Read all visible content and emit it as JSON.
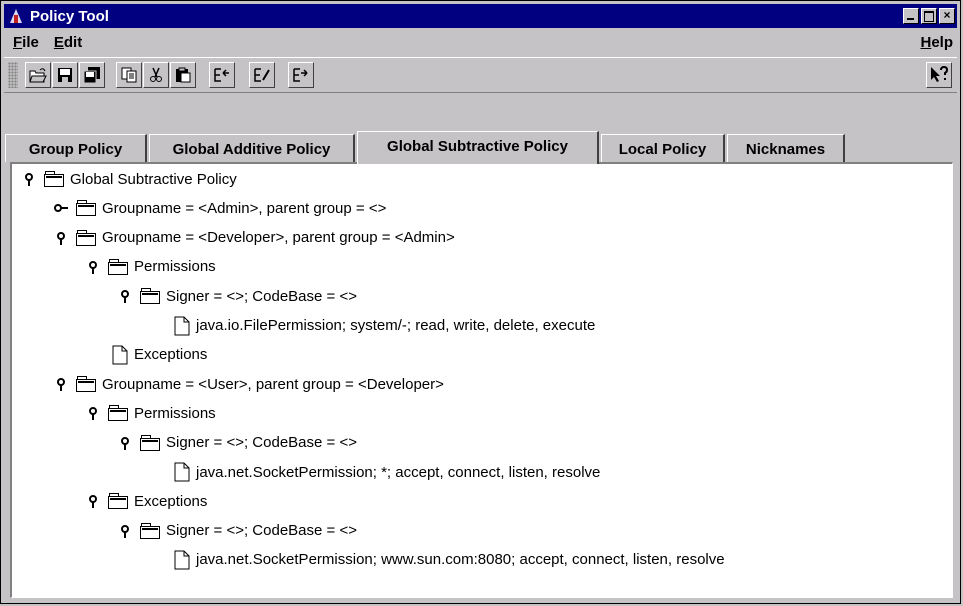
{
  "window": {
    "title": "Policy Tool",
    "close_glyph": "×"
  },
  "menubar": {
    "file": "File",
    "edit": "Edit",
    "help": "Help"
  },
  "toolbar": {
    "buttons": [
      {
        "name": "open-icon"
      },
      {
        "name": "save-icon"
      },
      {
        "name": "save-all-icon"
      },
      {
        "name": "copy-icon"
      },
      {
        "name": "cut-icon"
      },
      {
        "name": "paste-icon"
      },
      {
        "name": "add-entry-icon"
      },
      {
        "name": "edit-entry-icon"
      },
      {
        "name": "remove-entry-icon"
      },
      {
        "name": "context-help-icon"
      }
    ]
  },
  "tabs": [
    "Group Policy",
    "Global Additive Policy",
    "Global Subtractive Policy",
    "Local Policy",
    "Nicknames"
  ],
  "active_tab": "Global Subtractive Policy",
  "tree": [
    {
      "label": "Global Subtractive Policy",
      "kind": "folder",
      "expander": "open",
      "depth": 0
    },
    {
      "label": "Groupname = <Admin>, parent group = <>",
      "kind": "folder",
      "expander": "closed",
      "depth": 1
    },
    {
      "label": "Groupname = <Developer>, parent group = <Admin>",
      "kind": "folder",
      "expander": "open",
      "depth": 1
    },
    {
      "label": "Permissions",
      "kind": "folder",
      "expander": "open",
      "depth": 2
    },
    {
      "label": "Signer = <>; CodeBase = <>",
      "kind": "folder",
      "expander": "open",
      "depth": 3
    },
    {
      "label": "java.io.FilePermission; system/-; read, write, delete, execute",
      "kind": "leaf",
      "expander": "none",
      "depth": 4
    },
    {
      "label": "Exceptions",
      "kind": "leaf",
      "expander": "none",
      "depth": 2
    },
    {
      "label": "Groupname = <User>, parent group = <Developer>",
      "kind": "folder",
      "expander": "open",
      "depth": 1
    },
    {
      "label": "Permissions",
      "kind": "folder",
      "expander": "open",
      "depth": 2
    },
    {
      "label": "Signer = <>; CodeBase = <>",
      "kind": "folder",
      "expander": "open",
      "depth": 3
    },
    {
      "label": "java.net.SocketPermission; *; accept, connect, listen, resolve",
      "kind": "leaf",
      "expander": "none",
      "depth": 4
    },
    {
      "label": "Exceptions",
      "kind": "folder",
      "expander": "open",
      "depth": 2
    },
    {
      "label": "Signer = <>; CodeBase = <>",
      "kind": "folder",
      "expander": "open",
      "depth": 3
    },
    {
      "label": "java.net.SocketPermission; www.sun.com:8080; accept, connect, listen, resolve",
      "kind": "leaf",
      "expander": "none",
      "depth": 4
    }
  ]
}
